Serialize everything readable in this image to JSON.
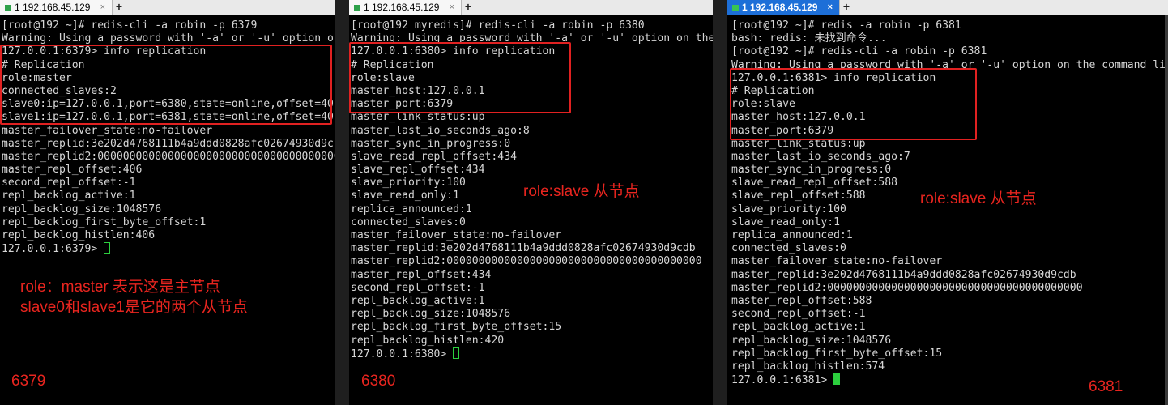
{
  "panes": [
    {
      "tab_label": "1 192.168.45.129",
      "tab_active": false,
      "lines": [
        "[root@192 ~]# redis-cli -a robin -p 6379",
        "Warning: Using a password with '-a' or '-u' option o",
        "127.0.0.1:6379> info replication",
        "# Replication",
        "role:master",
        "connected_slaves:2",
        "slave0:ip=127.0.0.1,port=6380,state=online,offset=40",
        "slave1:ip=127.0.0.1,port=6381,state=online,offset=40",
        "master_failover_state:no-failover",
        "master_replid:3e202d4768111b4a9ddd0828afc02674930d9c",
        "master_replid2:00000000000000000000000000000000000000",
        "master_repl_offset:406",
        "second_repl_offset:-1",
        "repl_backlog_active:1",
        "repl_backlog_size:1048576",
        "repl_backlog_first_byte_offset:1",
        "repl_backlog_histlen:406",
        "127.0.0.1:6379> "
      ],
      "annotations": [
        "role：master 表示这是主节点",
        "slave0和slave1是它的两个从节点"
      ],
      "port_label": "6379"
    },
    {
      "tab_label": "1 192.168.45.129",
      "tab_active": false,
      "lines": [
        "[root@192 myredis]# redis-cli -a robin -p 6380",
        "Warning: Using a password with '-a' or '-u' option on the",
        "127.0.0.1:6380> info replication",
        "# Replication",
        "role:slave",
        "master_host:127.0.0.1",
        "master_port:6379",
        "master_link_status:up",
        "master_last_io_seconds_ago:8",
        "master_sync_in_progress:0",
        "slave_read_repl_offset:434",
        "slave_repl_offset:434",
        "slave_priority:100",
        "slave_read_only:1",
        "replica_announced:1",
        "connected_slaves:0",
        "master_failover_state:no-failover",
        "master_replid:3e202d4768111b4a9ddd0828afc02674930d9cdb",
        "master_replid2:0000000000000000000000000000000000000000",
        "master_repl_offset:434",
        "second_repl_offset:-1",
        "repl_backlog_active:1",
        "repl_backlog_size:1048576",
        "repl_backlog_first_byte_offset:15",
        "repl_backlog_histlen:420",
        "127.0.0.1:6380> "
      ],
      "annotations": [
        "role:slave 从节点"
      ],
      "port_label": "6380"
    },
    {
      "tab_label": "1 192.168.45.129",
      "tab_active": true,
      "lines": [
        "[root@192 ~]# redis -a robin -p 6381",
        "bash: redis: 未找到命令...",
        "[root@192 ~]# redis-cli -a robin -p 6381",
        "Warning: Using a password with '-a' or '-u' option on the command li",
        "127.0.0.1:6381> info replication",
        "# Replication",
        "role:slave",
        "master_host:127.0.0.1",
        "master_port:6379",
        "master_link_status:up",
        "master_last_io_seconds_ago:7",
        "master_sync_in_progress:0",
        "slave_read_repl_offset:588",
        "slave_repl_offset:588",
        "slave_priority:100",
        "slave_read_only:1",
        "replica_announced:1",
        "connected_slaves:0",
        "master_failover_state:no-failover",
        "master_replid:3e202d4768111b4a9ddd0828afc02674930d9cdb",
        "master_replid2:0000000000000000000000000000000000000000",
        "master_repl_offset:588",
        "second_repl_offset:-1",
        "repl_backlog_active:1",
        "repl_backlog_size:1048576",
        "repl_backlog_first_byte_offset:15",
        "repl_backlog_histlen:574",
        "127.0.0.1:6381> "
      ],
      "annotations": [
        "role:slave 从节点"
      ],
      "port_label": "6381"
    }
  ],
  "tab_close_glyph": "×",
  "add_tab_glyph": "+",
  "colors": {
    "annotation": "#e8251f",
    "terminal_bg": "#000000",
    "cursor": "#2ccf3e",
    "active_tab": "#1d6fd8"
  }
}
